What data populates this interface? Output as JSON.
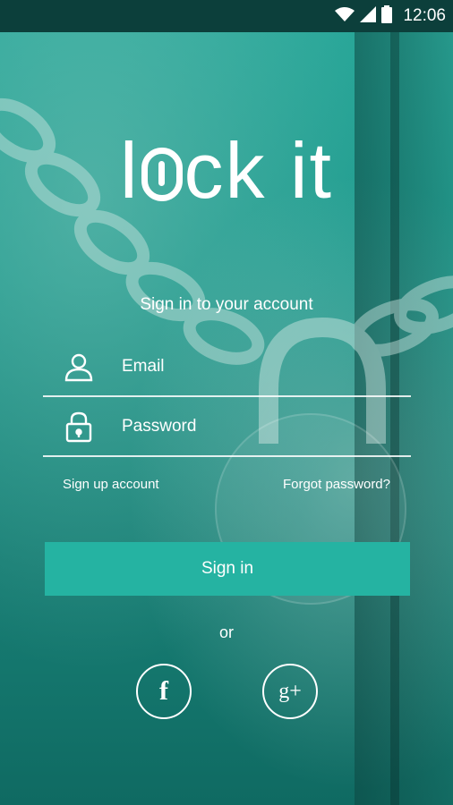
{
  "status_bar": {
    "time": "12:06"
  },
  "logo": {
    "part1": "l",
    "part2": "ck it"
  },
  "subtitle": "Sign in to your account",
  "form": {
    "email_placeholder": "Email",
    "password_placeholder": "Password"
  },
  "links": {
    "sign_up": "Sign up account",
    "forgot": "Forgot password?"
  },
  "sign_in_label": "Sign in",
  "or_label": "or",
  "social": {
    "facebook_glyph": "f",
    "google_glyph": "g+"
  },
  "colors": {
    "accent": "#25b3a2",
    "status_bar": "#0c3f3b"
  }
}
